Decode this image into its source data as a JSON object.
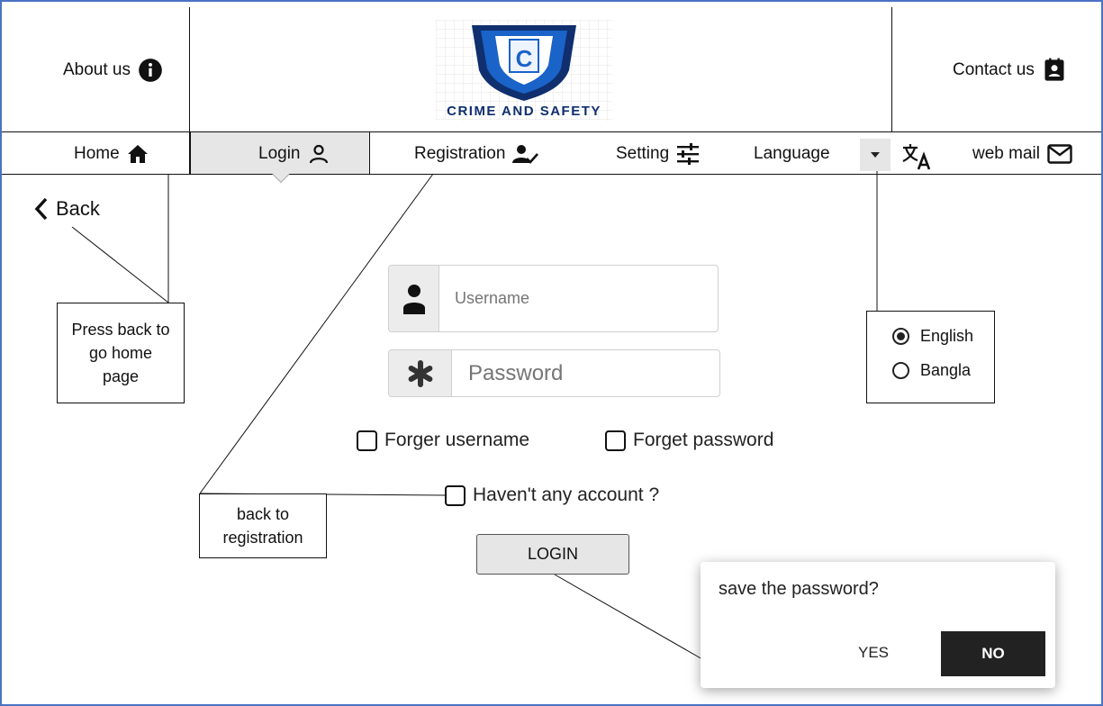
{
  "header": {
    "about_label": "About us",
    "contact_label": "Contact us",
    "logo_text": "CRIME AND SAFETY",
    "logo_letter": "C"
  },
  "nav": {
    "home": "Home",
    "login": "Login",
    "registration": "Registration",
    "setting": "Setting",
    "language": "Language",
    "webmail": "web mail"
  },
  "back_label": "Back",
  "form": {
    "username_placeholder": "Username",
    "password_placeholder": "Password",
    "forget_username": "Forger username",
    "forget_password": "Forget password",
    "no_account": "Haven't any account ?",
    "login_button": "LOGIN"
  },
  "notes": {
    "back_note": "Press back to go home page",
    "registration_note": "back to registration"
  },
  "language_options": {
    "english": "English",
    "bangla": "Bangla",
    "selected": "English"
  },
  "dialog": {
    "message": "save the password?",
    "yes": "YES",
    "no": "NO"
  },
  "colors": {
    "frame_border": "#4a72c4",
    "logo_blue": "#1a63c9",
    "logo_dark": "#0f2f6e",
    "active_tab": "#e6e6e6",
    "dialog_no_bg": "#222222"
  }
}
